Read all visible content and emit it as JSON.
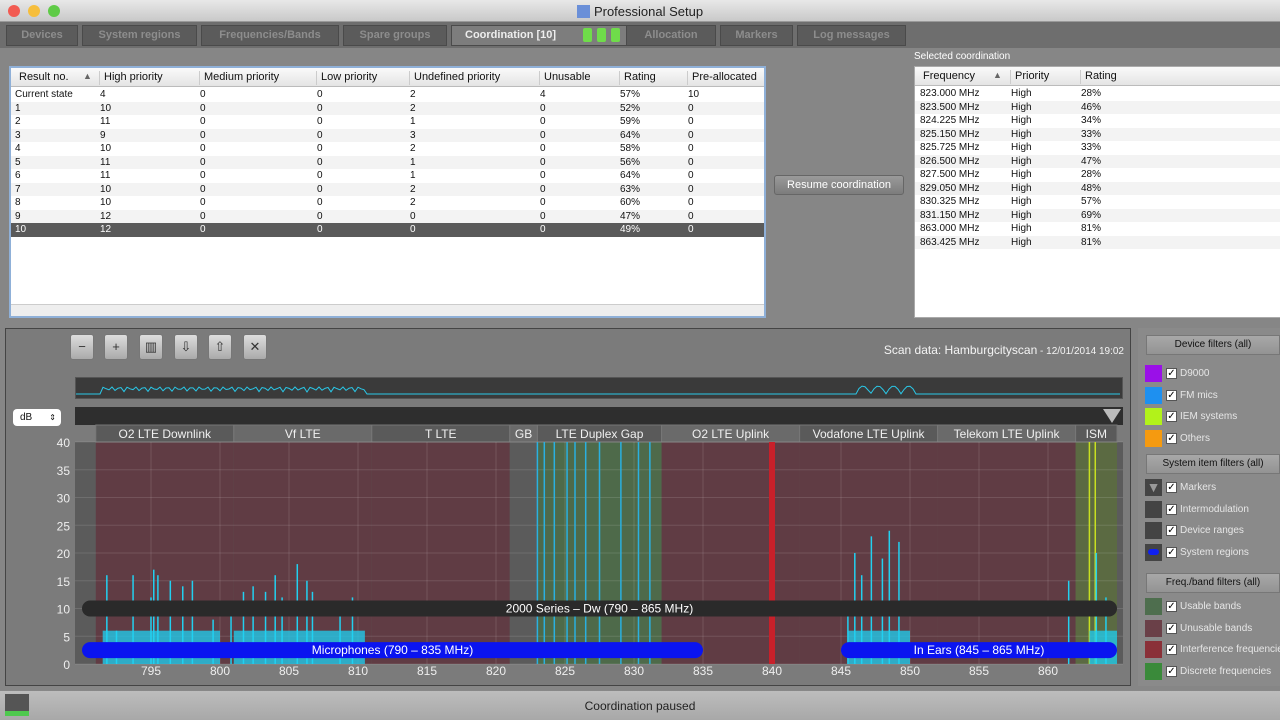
{
  "window": {
    "title": "Professional Setup"
  },
  "tabs": [
    {
      "label": "Devices"
    },
    {
      "label": "System regions"
    },
    {
      "label": "Frequencies/Bands"
    },
    {
      "label": "Spare groups"
    },
    {
      "label": "Coordination [10]"
    },
    {
      "label": "Allocation"
    },
    {
      "label": "Markers"
    },
    {
      "label": "Log messages"
    }
  ],
  "results": {
    "columns": [
      "Result no.",
      "High priority",
      "Medium priority",
      "Low priority",
      "Undefined priority",
      "Unusable",
      "Rating",
      "Pre-allocated"
    ],
    "rows": [
      [
        "Current state",
        "4",
        "0",
        "0",
        "2",
        "4",
        "57%",
        "10"
      ],
      [
        "1",
        "10",
        "0",
        "0",
        "2",
        "0",
        "52%",
        "0"
      ],
      [
        "2",
        "11",
        "0",
        "0",
        "1",
        "0",
        "59%",
        "0"
      ],
      [
        "3",
        "9",
        "0",
        "0",
        "3",
        "0",
        "64%",
        "0"
      ],
      [
        "4",
        "10",
        "0",
        "0",
        "2",
        "0",
        "58%",
        "0"
      ],
      [
        "5",
        "11",
        "0",
        "0",
        "1",
        "0",
        "56%",
        "0"
      ],
      [
        "6",
        "11",
        "0",
        "0",
        "1",
        "0",
        "64%",
        "0"
      ],
      [
        "7",
        "10",
        "0",
        "0",
        "2",
        "0",
        "63%",
        "0"
      ],
      [
        "8",
        "10",
        "0",
        "0",
        "2",
        "0",
        "60%",
        "0"
      ],
      [
        "9",
        "12",
        "0",
        "0",
        "0",
        "0",
        "47%",
        "0"
      ],
      [
        "10",
        "12",
        "0",
        "0",
        "0",
        "0",
        "49%",
        "0"
      ]
    ],
    "selected_row": 10
  },
  "resume_label": "Resume coordination",
  "selected": {
    "label": "Selected coordination",
    "columns": [
      "Frequency",
      "Priority",
      "Rating"
    ],
    "rows": [
      [
        "823.000 MHz",
        "High",
        "28%"
      ],
      [
        "823.500 MHz",
        "High",
        "46%"
      ],
      [
        "824.225 MHz",
        "High",
        "34%"
      ],
      [
        "825.150 MHz",
        "High",
        "33%"
      ],
      [
        "825.725 MHz",
        "High",
        "33%"
      ],
      [
        "826.500 MHz",
        "High",
        "47%"
      ],
      [
        "827.500 MHz",
        "High",
        "28%"
      ],
      [
        "829.050 MHz",
        "High",
        "48%"
      ],
      [
        "830.325 MHz",
        "High",
        "57%"
      ],
      [
        "831.150 MHz",
        "High",
        "69%"
      ],
      [
        "863.000 MHz",
        "High",
        "81%"
      ],
      [
        "863.425 MHz",
        "High",
        "81%"
      ]
    ]
  },
  "toolbar": [
    {
      "icon": "zoom-out-icon",
      "glyph": "−"
    },
    {
      "icon": "zoom-in-icon",
      "glyph": "+"
    },
    {
      "icon": "chart-icon",
      "glyph": "▥"
    },
    {
      "icon": "import-icon",
      "glyph": "⇩"
    },
    {
      "icon": "export-icon",
      "glyph": "⇧"
    },
    {
      "icon": "clear-icon",
      "glyph": "✕"
    }
  ],
  "scan": {
    "label": "Scan data: Hamburgcityscan",
    "date": " - 12/01/2014 19:02"
  },
  "unit_select": "dB",
  "chart_data": {
    "type": "area",
    "xlabel": "MHz",
    "ylabel": "dB",
    "xlim": [
      789.5,
      865.3
    ],
    "ylim": [
      0,
      40
    ],
    "xticks": [
      795,
      800,
      805,
      810,
      815,
      820,
      825,
      830,
      835,
      840,
      845,
      850,
      855,
      860
    ],
    "yticks": [
      0,
      5,
      10,
      15,
      20,
      25,
      30,
      35,
      40
    ],
    "bands": [
      {
        "name": "O2 LTE Downlink",
        "from": 791,
        "to": 801,
        "usable": false
      },
      {
        "name": "Vf LTE",
        "from": 801,
        "to": 811,
        "usable": false
      },
      {
        "name": "T LTE",
        "from": 811,
        "to": 821,
        "usable": false
      },
      {
        "name": "GB",
        "from": 821,
        "to": 823,
        "usable": null
      },
      {
        "name": "LTE Duplex Gap",
        "from": 823,
        "to": 832,
        "usable": true
      },
      {
        "name": "O2 LTE Uplink",
        "from": 832,
        "to": 842,
        "usable": false
      },
      {
        "name": "Vodafone LTE Uplink",
        "from": 842,
        "to": 852,
        "usable": false
      },
      {
        "name": "Telekom LTE Uplink",
        "from": 852,
        "to": 862,
        "usable": false
      },
      {
        "name": "ISM",
        "from": 862,
        "to": 865,
        "usable": true
      }
    ],
    "ranges": [
      {
        "label": "2000 Series – Dw (790 – 865 MHz)",
        "from": 790,
        "to": 865,
        "color": "#2a2a2a",
        "level": 10
      },
      {
        "label": "Microphones (790 – 835 MHz)",
        "from": 790,
        "to": 835,
        "color": "#0a14f0",
        "level": 2.5
      },
      {
        "label": "In Ears (845 – 865 MHz)",
        "from": 845,
        "to": 865,
        "color": "#0a14f0",
        "level": 2.5
      }
    ],
    "interference": [
      840.0
    ],
    "coordinated_frequencies": [
      823.0,
      823.5,
      824.225,
      825.15,
      825.725,
      826.5,
      827.5,
      829.05,
      830.325,
      831.15,
      863.0,
      863.425
    ],
    "spectrum_peaks": [
      [
        791.8,
        16
      ],
      [
        792.5,
        6
      ],
      [
        793.7,
        16
      ],
      [
        795,
        12
      ],
      [
        795.2,
        17
      ],
      [
        795.5,
        16
      ],
      [
        796.4,
        15
      ],
      [
        797.3,
        14
      ],
      [
        798,
        15
      ],
      [
        799.5,
        8
      ],
      [
        800.8,
        10
      ],
      [
        801.7,
        13
      ],
      [
        802.4,
        14
      ],
      [
        803.3,
        13
      ],
      [
        804,
        16
      ],
      [
        804.5,
        12
      ],
      [
        805.6,
        18
      ],
      [
        806.3,
        15
      ],
      [
        806.7,
        13
      ],
      [
        808.7,
        11
      ],
      [
        809.6,
        12
      ],
      [
        845.5,
        11
      ],
      [
        846,
        20
      ],
      [
        846.5,
        16
      ],
      [
        847.2,
        23
      ],
      [
        848,
        19
      ],
      [
        848.5,
        24
      ],
      [
        849.2,
        22
      ],
      [
        861.5,
        15
      ],
      [
        863.5,
        20
      ],
      [
        864.2,
        12
      ]
    ]
  },
  "filters": {
    "device": {
      "title": "Device filters (all)",
      "items": [
        {
          "label": "D9000",
          "color": "#9a10e8"
        },
        {
          "label": "FM mics",
          "color": "#1e90f0"
        },
        {
          "label": "IEM systems",
          "color": "#b2f21a"
        },
        {
          "label": "Others",
          "color": "#f59a10"
        }
      ]
    },
    "system": {
      "title": "System item filters (all)",
      "items": [
        {
          "label": "Markers"
        },
        {
          "label": "Intermodulation"
        },
        {
          "label": "Device ranges"
        },
        {
          "label": "System regions"
        }
      ]
    },
    "band": {
      "title": "Freq./band filters (all)",
      "items": [
        {
          "label": "Usable bands",
          "color": "#4e6e4e"
        },
        {
          "label": "Unusable bands",
          "color": "#6a4048"
        },
        {
          "label": "Interference frequencies",
          "color": "#8a3038"
        },
        {
          "label": "Discrete frequencies",
          "color": "#3a8a3a"
        }
      ]
    }
  },
  "status": "Coordination paused"
}
